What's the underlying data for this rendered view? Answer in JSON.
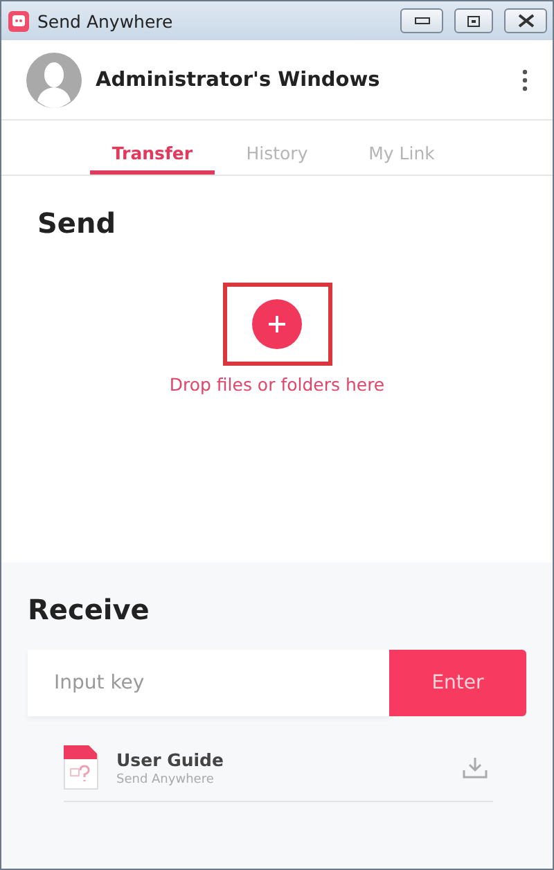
{
  "window": {
    "title": "Send Anywhere"
  },
  "header": {
    "device_name": "Administrator's Windows"
  },
  "tabs": [
    {
      "label": "Transfer",
      "selected": true
    },
    {
      "label": "History",
      "selected": false
    },
    {
      "label": "My Link",
      "selected": false
    }
  ],
  "send": {
    "title": "Send",
    "hint": "Drop files or folders here",
    "highlighted": true
  },
  "receive": {
    "title": "Receive",
    "placeholder": "Input key",
    "button": "Enter"
  },
  "files": [
    {
      "name": "User Guide",
      "source": "Send Anywhere"
    }
  ]
}
